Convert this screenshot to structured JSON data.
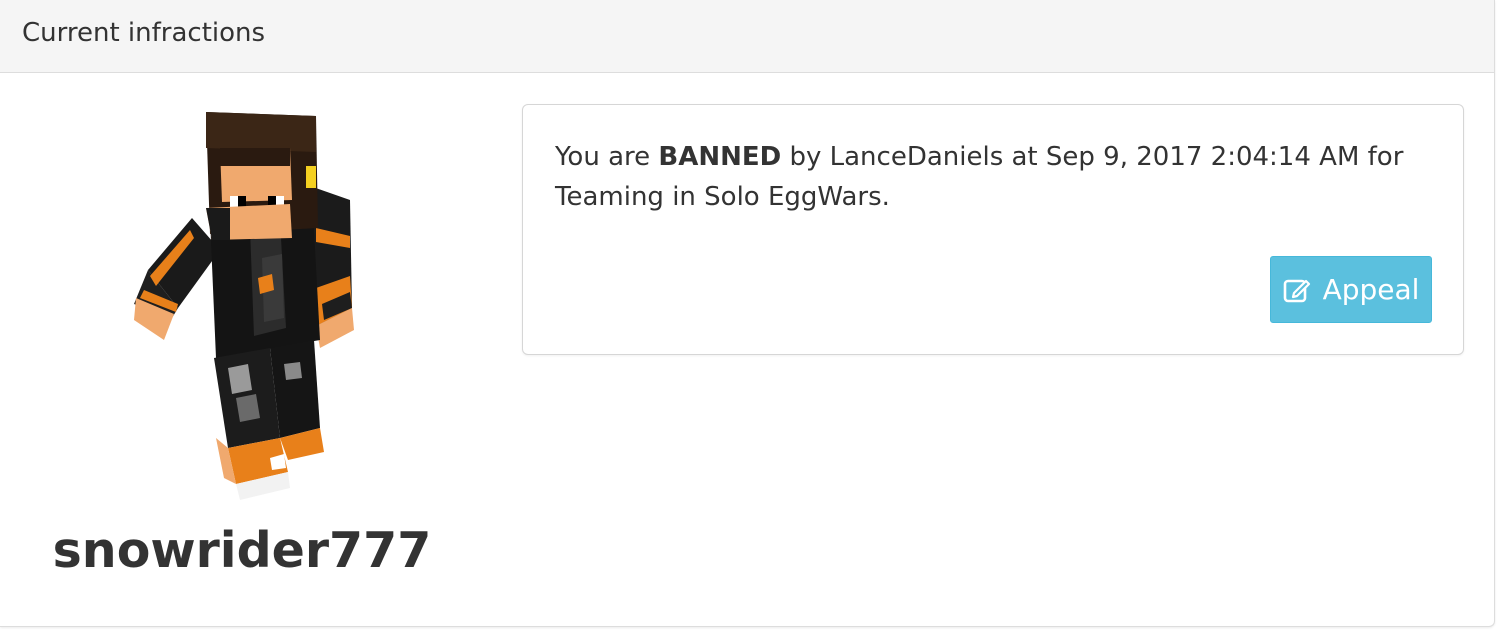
{
  "panel": {
    "title": "Current infractions"
  },
  "player": {
    "username": "snowrider777",
    "avatar": "minecraft-skin-render"
  },
  "infraction": {
    "prefix": "You are ",
    "status": "BANNED",
    "by_label": " by ",
    "moderator": "LanceDaniels",
    "at_label": " at ",
    "timestamp": "Sep 9, 2017 2:04:14 AM",
    "for_label": " for ",
    "reason": "Teaming in Solo EggWars",
    "suffix": "."
  },
  "appeal_button": {
    "label": "Appeal",
    "icon": "edit-icon",
    "color": "#5bc0de"
  }
}
